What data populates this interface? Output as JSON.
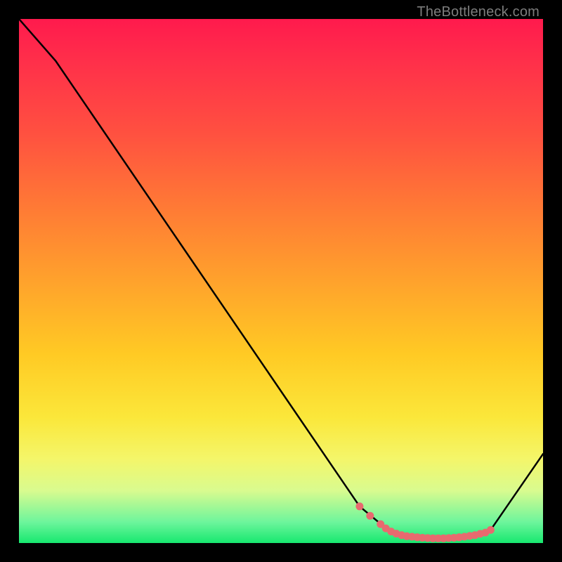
{
  "attribution": "TheBottleneck.com",
  "chart_data": {
    "type": "line",
    "title": "",
    "xlabel": "",
    "ylabel": "",
    "xlim": [
      0,
      100
    ],
    "ylim": [
      0,
      100
    ],
    "series": [
      {
        "name": "curve",
        "x": [
          0,
          7,
          65,
          71,
          73,
          75,
          77,
          79,
          81,
          83,
          85,
          87,
          89,
          90,
          100
        ],
        "y": [
          100,
          92,
          7,
          2,
          1.5,
          1.2,
          1.0,
          0.9,
          0.9,
          1.0,
          1.2,
          1.5,
          2.0,
          2.5,
          17
        ]
      }
    ],
    "markers": {
      "name": "highlight-points",
      "color": "#e86a6f",
      "x": [
        65,
        67,
        69,
        70,
        71,
        72,
        73,
        74,
        75,
        76,
        77,
        78,
        79,
        80,
        81,
        82,
        83,
        84,
        85,
        86,
        87,
        88,
        89,
        90
      ],
      "y": [
        7.0,
        5.2,
        3.6,
        2.8,
        2.2,
        1.8,
        1.5,
        1.3,
        1.2,
        1.1,
        1.0,
        0.95,
        0.9,
        0.9,
        0.9,
        0.95,
        1.0,
        1.1,
        1.2,
        1.35,
        1.5,
        1.75,
        2.0,
        2.5
      ]
    }
  },
  "colors": {
    "background": "#000000",
    "curve": "#000000",
    "marker": "#e86a6f"
  }
}
